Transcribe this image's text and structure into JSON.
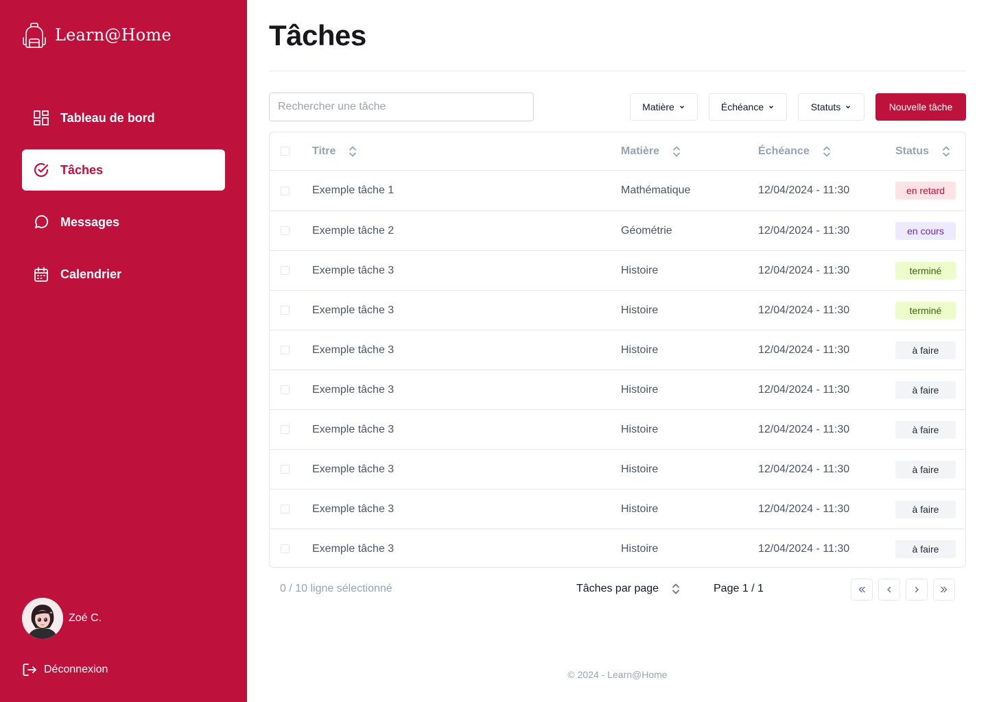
{
  "app": {
    "name": "Learn@Home"
  },
  "colors": {
    "brand": "#be123c",
    "late": "#be123c",
    "in_progress": "#6d28d9",
    "done": "#3f6212"
  },
  "sidebar": {
    "items": [
      {
        "label": "Tableau de bord",
        "icon": "dashboard-icon",
        "active": false
      },
      {
        "label": "Tâches",
        "icon": "check-circle-icon",
        "active": true
      },
      {
        "label": "Messages",
        "icon": "message-icon",
        "active": false
      },
      {
        "label": "Calendrier",
        "icon": "calendar-icon",
        "active": false
      }
    ],
    "user": {
      "name": "Zoé C."
    },
    "logout_label": "Déconnexion"
  },
  "header": {
    "title": "Tâches"
  },
  "toolbar": {
    "search_placeholder": "Rechercher une tâche",
    "filters": [
      "Matière",
      "Échéance",
      "Statuts"
    ],
    "new_task_label": "Nouvelle tâche"
  },
  "table": {
    "columns": [
      "Titre",
      "Matière",
      "Échéance",
      "Status"
    ],
    "rows": [
      {
        "title": "Exemple tâche 1",
        "subject": "Mathématique",
        "due": "12/04/2024 - 11:30",
        "status": "en retard",
        "status_type": "late"
      },
      {
        "title": "Exemple tâche 2",
        "subject": "Géométrie",
        "due": "12/04/2024 - 11:30",
        "status": "en cours",
        "status_type": "progress"
      },
      {
        "title": "Exemple tâche 3",
        "subject": "Histoire",
        "due": "12/04/2024 - 11:30",
        "status": "terminé",
        "status_type": "done"
      },
      {
        "title": "Exemple tâche 3",
        "subject": "Histoire",
        "due": "12/04/2024 - 11:30",
        "status": "terminé",
        "status_type": "done"
      },
      {
        "title": "Exemple tâche 3",
        "subject": "Histoire",
        "due": "12/04/2024 - 11:30",
        "status": "à faire",
        "status_type": "todo"
      },
      {
        "title": "Exemple tâche 3",
        "subject": "Histoire",
        "due": "12/04/2024 - 11:30",
        "status": "à faire",
        "status_type": "todo"
      },
      {
        "title": "Exemple tâche 3",
        "subject": "Histoire",
        "due": "12/04/2024 - 11:30",
        "status": "à faire",
        "status_type": "todo"
      },
      {
        "title": "Exemple tâche 3",
        "subject": "Histoire",
        "due": "12/04/2024 - 11:30",
        "status": "à faire",
        "status_type": "todo"
      },
      {
        "title": "Exemple tâche 3",
        "subject": "Histoire",
        "due": "12/04/2024 - 11:30",
        "status": "à faire",
        "status_type": "todo"
      },
      {
        "title": "Exemple tâche 3",
        "subject": "Histoire",
        "due": "12/04/2024 - 11:30",
        "status": "à faire",
        "status_type": "todo"
      }
    ]
  },
  "pagination": {
    "selection": "0 / 10 ligne sélectionné",
    "per_page_label": "Tâches par page",
    "page_info": "Page 1 / 1"
  },
  "footer": {
    "text": "© 2024 - Learn@Home"
  }
}
